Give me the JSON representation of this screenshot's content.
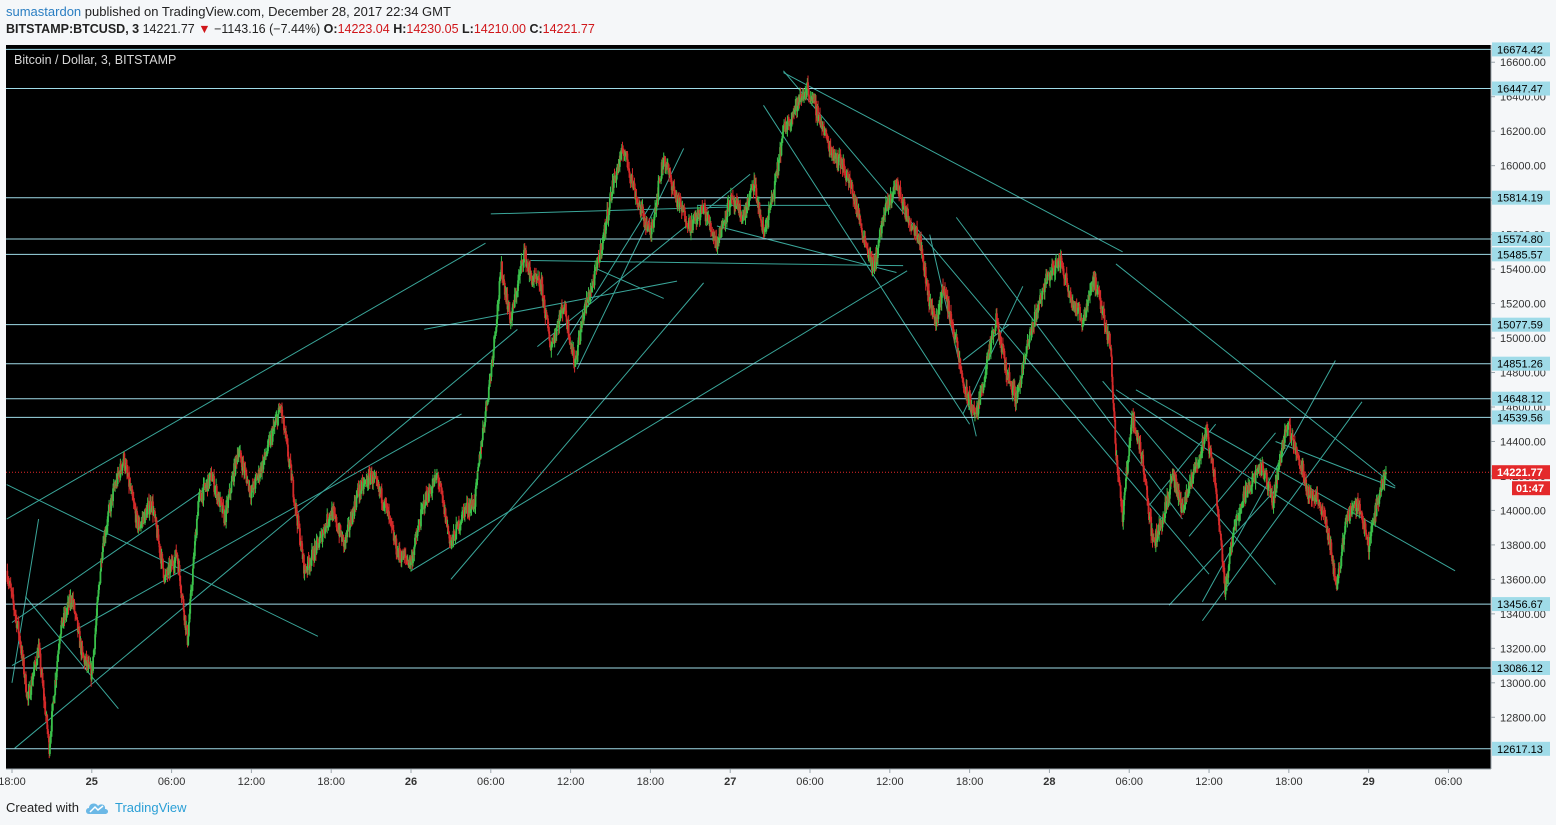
{
  "header": {
    "user": "sumastardon",
    "published_text": "published on TradingView.com, December 28, 2017 22:34 GMT",
    "symbol": "BITSTAMP:BTCUSD, 3",
    "last": "14221.77",
    "change": "−1143.16 (−7.44%)",
    "o_label": "O:",
    "o": "14223.04",
    "h_label": "H:",
    "h": "14230.05",
    "l_label": "L:",
    "l": "14210.00",
    "c_label": "C:",
    "c": "14221.77"
  },
  "footer": {
    "created_with": "Created with",
    "brand": "TradingView"
  },
  "colors": {
    "background": "#000000",
    "level_line": "#9fdbe8",
    "trend_line": "#3aa69a",
    "up_candle": "#3ac04a",
    "down_candle": "#d52a2a",
    "price_line": "#e4292b",
    "axis_bg": "#f5f7f9"
  },
  "chart_data": {
    "type": "candlestick",
    "title": "Bitcoin / Dollar, 3, BITSTAMP",
    "ylim": [
      12500,
      16700
    ],
    "y_ticks": [
      12800,
      13000,
      13200,
      13400,
      13600,
      13800,
      14000,
      14200,
      14400,
      14600,
      14800,
      15000,
      15200,
      15400,
      15600,
      15800,
      16000,
      16200,
      16400,
      16600
    ],
    "y_tick_labels": [
      "12800.00",
      "13000.00",
      "13200.00",
      "13400.00",
      "13600.00",
      "13800.00",
      "14000.00",
      "14200.00",
      "14400.00",
      "14600.00",
      "14800.00",
      "15000.00",
      "15200.00",
      "15400.00",
      "15600.00",
      "15800.00",
      "16000.00",
      "16200.00",
      "16400.00",
      "16600.00"
    ],
    "x_tick_labels": [
      "18:00",
      "25",
      "06:00",
      "12:00",
      "18:00",
      "26",
      "06:00",
      "12:00",
      "18:00",
      "27",
      "06:00",
      "12:00",
      "18:00",
      "28",
      "06:00",
      "12:00",
      "18:00",
      "29",
      "06:00"
    ],
    "x_ticks_hours": [
      18,
      24,
      30,
      36,
      42,
      48,
      54,
      60,
      66,
      72,
      78,
      84,
      90,
      96,
      102,
      108,
      114,
      120,
      126
    ],
    "x_range_hours": [
      17.55,
      129.2
    ],
    "horizontal_levels": [
      16674.42,
      16447.47,
      15814.19,
      15574.8,
      15485.57,
      15077.59,
      14851.26,
      14648.12,
      14539.56,
      13456.67,
      13086.12,
      12617.13
    ],
    "horizontal_level_labels": [
      "16674.42",
      "16447.47",
      "15814.19",
      "15574.80",
      "15485.57",
      "15077.59",
      "14851.26",
      "14648.12",
      "14539.56",
      "13456.67",
      "13086.12",
      "12617.13"
    ],
    "last_price": 14221.77,
    "last_price_label": "14221.77",
    "countdown": "01:47",
    "price_path": [
      [
        17.6,
        13650
      ],
      [
        18.5,
        13300
      ],
      [
        19.2,
        12900
      ],
      [
        20.0,
        13200
      ],
      [
        20.8,
        12630
      ],
      [
        21.6,
        13300
      ],
      [
        22.5,
        13500
      ],
      [
        23.3,
        13150
      ],
      [
        24.0,
        13050
      ],
      [
        24.8,
        13800
      ],
      [
        25.6,
        14100
      ],
      [
        26.4,
        14300
      ],
      [
        27.5,
        13900
      ],
      [
        28.5,
        14050
      ],
      [
        29.5,
        13600
      ],
      [
        30.4,
        13750
      ],
      [
        31.2,
        13250
      ],
      [
        32.0,
        14050
      ],
      [
        33.0,
        14200
      ],
      [
        34.0,
        13950
      ],
      [
        35.0,
        14350
      ],
      [
        36.0,
        14100
      ],
      [
        37.0,
        14300
      ],
      [
        38.2,
        14600
      ],
      [
        39.0,
        14200
      ],
      [
        40.0,
        13650
      ],
      [
        41.0,
        13800
      ],
      [
        42.0,
        14000
      ],
      [
        43.0,
        13800
      ],
      [
        44.0,
        14100
      ],
      [
        45.0,
        14200
      ],
      [
        46.0,
        14050
      ],
      [
        47.0,
        13750
      ],
      [
        48.0,
        13700
      ],
      [
        49.0,
        14050
      ],
      [
        50.0,
        14200
      ],
      [
        51.0,
        13800
      ],
      [
        52.0,
        14000
      ],
      [
        52.8,
        14050
      ],
      [
        53.3,
        14400
      ],
      [
        54.0,
        14800
      ],
      [
        54.8,
        15400
      ],
      [
        55.5,
        15100
      ],
      [
        56.5,
        15500
      ],
      [
        57.0,
        15350
      ],
      [
        57.8,
        15300
      ],
      [
        58.5,
        14950
      ],
      [
        59.5,
        15200
      ],
      [
        60.3,
        14850
      ],
      [
        61.0,
        15150
      ],
      [
        61.8,
        15350
      ],
      [
        62.5,
        15600
      ],
      [
        63.2,
        15900
      ],
      [
        64.0,
        16100
      ],
      [
        65.0,
        15800
      ],
      [
        66.0,
        15600
      ],
      [
        67.0,
        16050
      ],
      [
        68.0,
        15800
      ],
      [
        69.0,
        15650
      ],
      [
        70.0,
        15750
      ],
      [
        71.0,
        15550
      ],
      [
        72.0,
        15800
      ],
      [
        73.0,
        15700
      ],
      [
        73.8,
        15900
      ],
      [
        74.5,
        15600
      ],
      [
        75.3,
        15850
      ],
      [
        76.0,
        16200
      ],
      [
        77.0,
        16350
      ],
      [
        77.8,
        16450
      ],
      [
        78.6,
        16300
      ],
      [
        79.5,
        16100
      ],
      [
        80.5,
        16000
      ],
      [
        81.2,
        15850
      ],
      [
        82.0,
        15600
      ],
      [
        82.8,
        15400
      ],
      [
        83.5,
        15700
      ],
      [
        84.5,
        15900
      ],
      [
        85.3,
        15700
      ],
      [
        86.2,
        15600
      ],
      [
        87.0,
        15200
      ],
      [
        87.5,
        15100
      ],
      [
        88.0,
        15300
      ],
      [
        88.8,
        15050
      ],
      [
        89.6,
        14700
      ],
      [
        90.5,
        14550
      ],
      [
        91.3,
        14850
      ],
      [
        92.0,
        15100
      ],
      [
        92.8,
        14800
      ],
      [
        93.5,
        14650
      ],
      [
        94.2,
        14900
      ],
      [
        95.0,
        15150
      ],
      [
        95.8,
        15350
      ],
      [
        96.8,
        15450
      ],
      [
        97.8,
        15200
      ],
      [
        98.5,
        15100
      ],
      [
        99.3,
        15350
      ],
      [
        100.0,
        15150
      ],
      [
        100.6,
        14950
      ],
      [
        101.0,
        14350
      ],
      [
        101.5,
        13950
      ],
      [
        102.2,
        14550
      ],
      [
        103.0,
        14300
      ],
      [
        103.8,
        13800
      ],
      [
        104.5,
        13950
      ],
      [
        105.3,
        14200
      ],
      [
        106.0,
        14000
      ],
      [
        107.0,
        14250
      ],
      [
        107.8,
        14450
      ],
      [
        108.5,
        14150
      ],
      [
        109.2,
        13550
      ],
      [
        110.0,
        13950
      ],
      [
        111.0,
        14150
      ],
      [
        112.0,
        14250
      ],
      [
        112.8,
        14050
      ],
      [
        113.8,
        14500
      ],
      [
        114.6,
        14350
      ],
      [
        115.5,
        14100
      ],
      [
        116.3,
        14050
      ],
      [
        117.0,
        13850
      ],
      [
        117.6,
        13550
      ],
      [
        118.3,
        13950
      ],
      [
        119.2,
        14050
      ],
      [
        120.0,
        13800
      ],
      [
        120.8,
        14100
      ],
      [
        121.3,
        14220
      ]
    ],
    "trend_lines": [
      [
        [
          17.6,
          13950
        ],
        [
          53.6,
          15550
        ]
      ],
      [
        [
          18.2,
          12620
        ],
        [
          56.0,
          15050
        ]
      ],
      [
        [
          18.0,
          13100
        ],
        [
          51.8,
          14560
        ]
      ],
      [
        [
          17.6,
          14150
        ],
        [
          41.0,
          13270
        ]
      ],
      [
        [
          20.0,
          13950
        ],
        [
          18.0,
          13000
        ]
      ],
      [
        [
          19.0,
          13500
        ],
        [
          26.0,
          12850
        ]
      ],
      [
        [
          18.0,
          13350
        ],
        [
          33.0,
          14150
        ]
      ],
      [
        [
          51.0,
          13600
        ],
        [
          70.0,
          15320
        ]
      ],
      [
        [
          49.0,
          15050
        ],
        [
          68.0,
          15330
        ]
      ],
      [
        [
          48.0,
          13650
        ],
        [
          85.3,
          15390
        ]
      ],
      [
        [
          71.0,
          15650
        ],
        [
          84.5,
          15380
        ]
      ],
      [
        [
          69.5,
          15770
        ],
        [
          79.5,
          15770
        ]
      ],
      [
        [
          62.0,
          15400
        ],
        [
          67.0,
          15230
        ]
      ],
      [
        [
          59.0,
          14900
        ],
        [
          66.0,
          15770
        ]
      ],
      [
        [
          57.5,
          14950
        ],
        [
          73.5,
          15950
        ]
      ],
      [
        [
          60.5,
          14820
        ],
        [
          68.5,
          16100
        ]
      ],
      [
        [
          57.0,
          15450
        ],
        [
          85.0,
          15420
        ]
      ],
      [
        [
          54.0,
          15720
        ],
        [
          72.0,
          15760
        ]
      ],
      [
        [
          76.0,
          16550
        ],
        [
          108.0,
          13630
        ]
      ],
      [
        [
          74.5,
          16350
        ],
        [
          90.0,
          14500
        ]
      ],
      [
        [
          87.0,
          15600
        ],
        [
          90.5,
          14430
        ]
      ],
      [
        [
          89.0,
          15700
        ],
        [
          106.0,
          13950
        ]
      ],
      [
        [
          76.0,
          16540
        ],
        [
          101.5,
          15500
        ]
      ],
      [
        [
          101.0,
          15430
        ],
        [
          122.0,
          14140
        ]
      ],
      [
        [
          89.5,
          14560
        ],
        [
          94.0,
          15300
        ]
      ],
      [
        [
          89.5,
          14870
        ],
        [
          93.0,
          15080
        ]
      ],
      [
        [
          100.0,
          14750
        ],
        [
          113.0,
          13570
        ]
      ],
      [
        [
          101.0,
          14700
        ],
        [
          117.0,
          13890
        ]
      ],
      [
        [
          103.5,
          14030
        ],
        [
          108.5,
          14500
        ]
      ],
      [
        [
          105.0,
          13450
        ],
        [
          113.0,
          14120
        ]
      ],
      [
        [
          107.5,
          13470
        ],
        [
          117.5,
          14870
        ]
      ],
      [
        [
          107.5,
          13360
        ],
        [
          119.5,
          14630
        ]
      ],
      [
        [
          106.5,
          13850
        ],
        [
          113.0,
          14450
        ]
      ],
      [
        [
          102.5,
          14700
        ],
        [
          126.5,
          13650
        ]
      ],
      [
        [
          113.0,
          14400
        ],
        [
          122.0,
          14130
        ]
      ]
    ]
  }
}
